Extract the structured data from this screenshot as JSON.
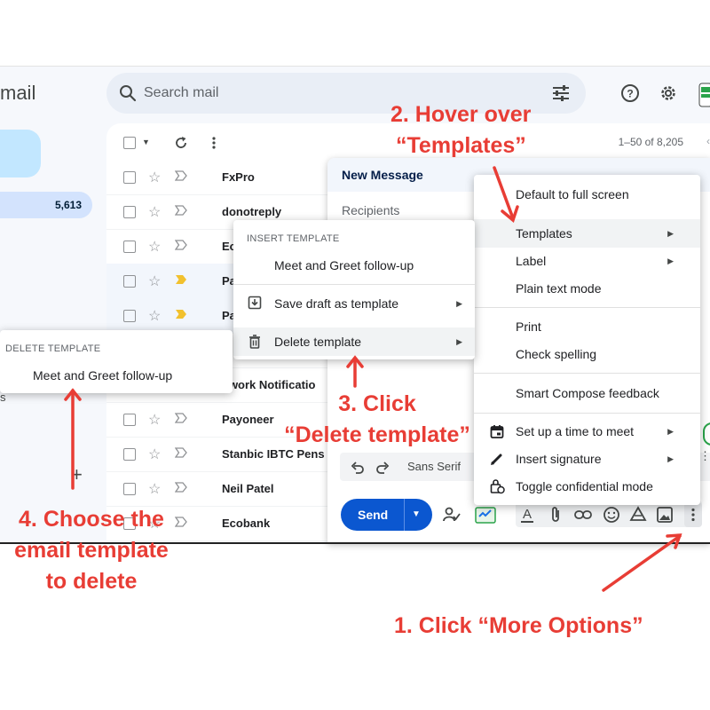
{
  "app": {
    "logo_text": "mail",
    "inbox_count": "5,613",
    "sidebar_s": "s",
    "sidebar_plus": "+"
  },
  "search": {
    "placeholder": "Search mail"
  },
  "toolbar": {
    "range": "1–50 of 8,205"
  },
  "emails": [
    {
      "sender": "FxPro",
      "important": false
    },
    {
      "sender": "donotreply",
      "important": false
    },
    {
      "sender": "Ec",
      "important": false
    },
    {
      "sender": "Pa",
      "important": true
    },
    {
      "sender": "Pa",
      "important": true
    },
    {
      "sender": "",
      "important": false
    },
    {
      "sender": "owork Notificatio",
      "important": false
    },
    {
      "sender": "Payoneer",
      "important": false
    },
    {
      "sender": "Stanbic IBTC Pens",
      "important": false
    },
    {
      "sender": "Neil Patel",
      "important": false
    },
    {
      "sender": "Ecobank",
      "important": false
    }
  ],
  "compose": {
    "title": "New Message",
    "recipients_placeholder": "Recipients",
    "font": "Sans Serif",
    "send_label": "Send"
  },
  "more_menu": {
    "items": [
      "Default to full screen",
      "Templates",
      "Label",
      "Plain text mode",
      "Print",
      "Check spelling",
      "Smart Compose feedback",
      "Set up a time to meet",
      "Insert signature",
      "Toggle confidential mode"
    ]
  },
  "templates_menu": {
    "header": "INSERT TEMPLATE",
    "insert_item": "Meet and Greet follow-up",
    "save_item": "Save draft as template",
    "delete_item": "Delete template"
  },
  "delete_menu": {
    "header": "DELETE TEMPLATE",
    "item": "Meet and Greet follow-up"
  },
  "annotations": {
    "step1": "1. Click “More Options”",
    "step2_line1": "2. Hover over",
    "step2_line2": "“Templates”",
    "step3_line1": "3. Click",
    "step3_line2": "“Delete template”",
    "step4_line1": "4. Choose the",
    "step4_line2": "email template",
    "step4_line3": "to delete"
  },
  "colors": {
    "annotation": "#e83d35",
    "send_button": "#0b57d0",
    "important_marker": "#f2c12e"
  }
}
